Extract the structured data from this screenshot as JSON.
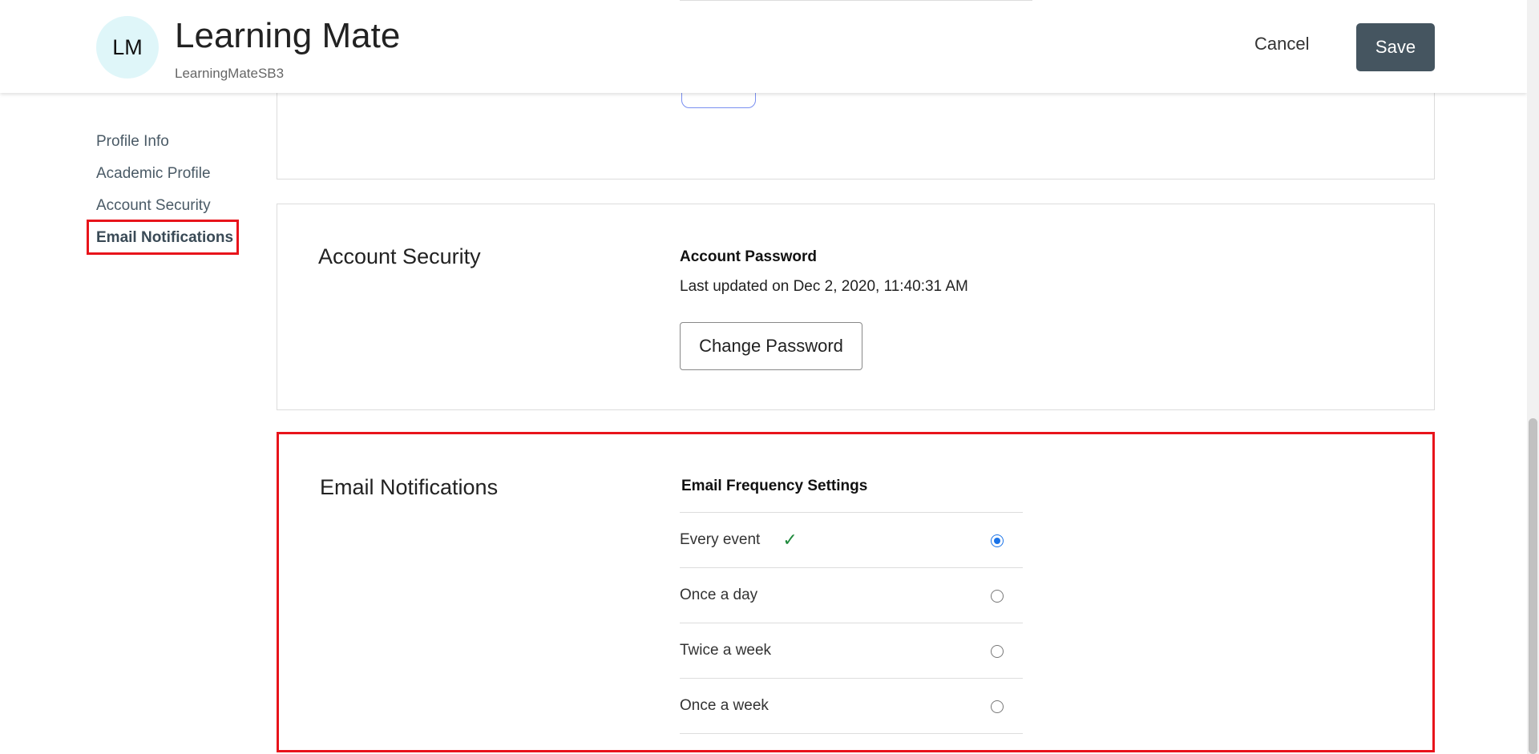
{
  "header": {
    "avatar_initials": "LM",
    "org_name": "Learning Mate",
    "org_id": "LearningMateSB3",
    "cancel_label": "Cancel",
    "save_label": "Save"
  },
  "sidebar": {
    "items": [
      {
        "label": "Profile Info"
      },
      {
        "label": "Academic Profile"
      },
      {
        "label": "Account Security"
      },
      {
        "label": "Email Notifications",
        "active": true
      }
    ]
  },
  "account_security": {
    "title": "Account Security",
    "password_label": "Account Password",
    "last_updated": "Last updated on Dec 2, 2020, 11:40:31 AM",
    "change_password_label": "Change Password"
  },
  "email_notifications": {
    "title": "Email Notifications",
    "frequency_label": "Email Frequency Settings",
    "options": [
      {
        "label": "Every event",
        "selected": true
      },
      {
        "label": "Once a day",
        "selected": false
      },
      {
        "label": "Twice a week",
        "selected": false
      },
      {
        "label": "Once a week",
        "selected": false
      }
    ]
  },
  "colors": {
    "accent": "#455560",
    "highlight": "#e8141b",
    "radio_selected": "#1a73e8",
    "check": "#1f8a3c",
    "avatar_bg": "#dff6f9"
  }
}
